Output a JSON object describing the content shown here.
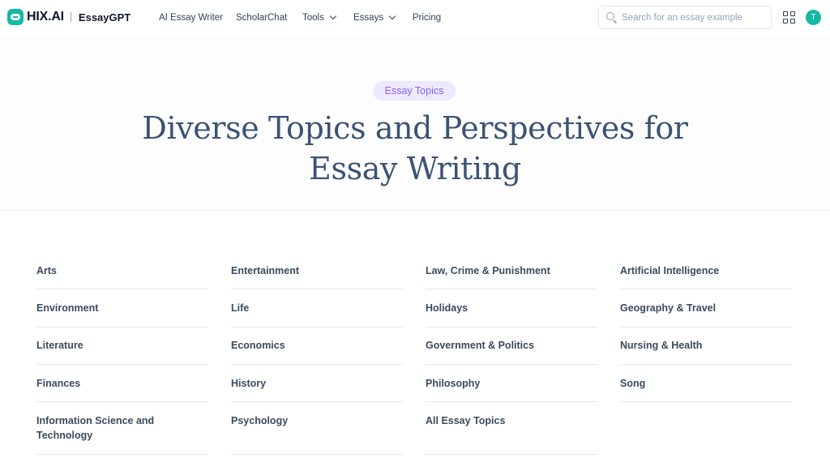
{
  "brand": {
    "name": "HIX.AI",
    "product": "EssayGPT"
  },
  "nav": {
    "links": [
      "AI Essay Writer",
      "ScholarChat",
      "Tools",
      "Essays",
      "Pricing"
    ]
  },
  "search": {
    "placeholder": "Search for an essay example"
  },
  "user": {
    "initial": "T"
  },
  "hero": {
    "badge": "Essay Topics",
    "title_line1": "Diverse Topics and Perspectives for",
    "title_line2": "Essay Writing"
  },
  "topics": {
    "col1": [
      "Arts",
      "Environment",
      "Literature",
      "Finances",
      "Information Science and Technology"
    ],
    "col2": [
      "Entertainment",
      "Life",
      "Economics",
      "History",
      "Psychology"
    ],
    "col3": [
      "Law, Crime & Punishment",
      "Holidays",
      "Government & Politics",
      "Philosophy",
      "All Essay Topics"
    ],
    "col4": [
      "Artificial Intelligence",
      "Geography & Travel",
      "Nursing & Health",
      "Song"
    ]
  },
  "colors": {
    "accent": "#14b8a6",
    "badge_bg": "#ede9fe",
    "badge_text": "#8b5cf6",
    "title": "#3b5374"
  }
}
